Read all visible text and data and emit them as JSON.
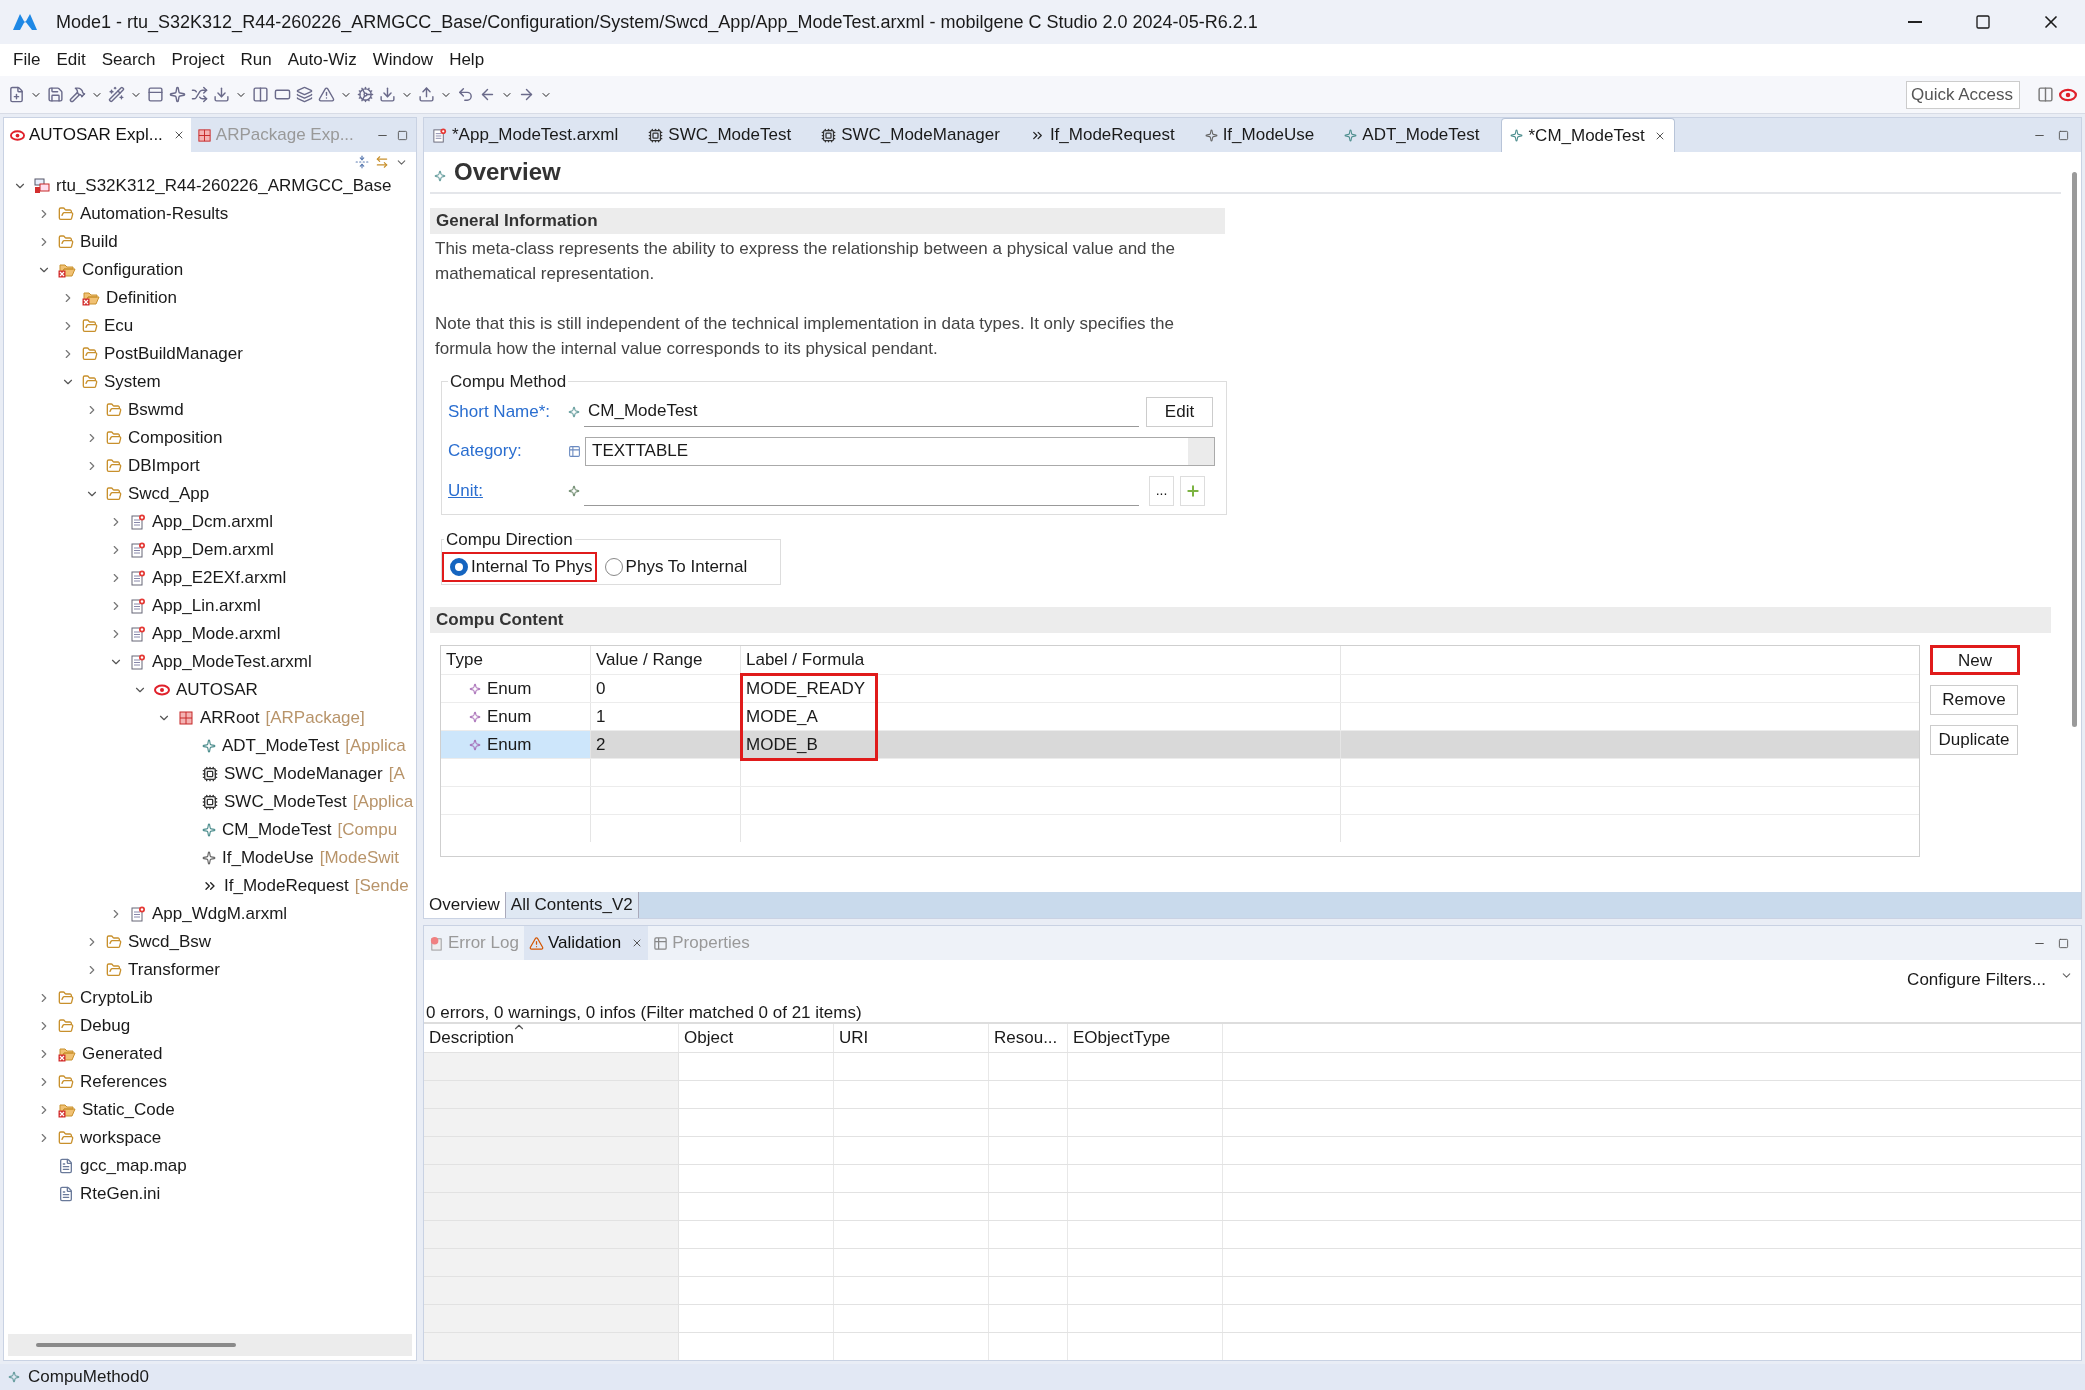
{
  "window": {
    "title": "Mode1 - rtu_S32K312_R44-260226_ARMGCC_Base/Configuration/System/Swcd_App/App_ModeTest.arxml - mobilgene C Studio 2.0 2024-05-R6.2.1"
  },
  "menu": [
    "File",
    "Edit",
    "Search",
    "Project",
    "Run",
    "Auto-Wiz",
    "Window",
    "Help"
  ],
  "quick_access": {
    "placeholder": "Quick Access"
  },
  "left_views": [
    {
      "label": "AUTOSAR Expl...",
      "selected": true,
      "kind": "autosar"
    },
    {
      "label": "ARPackage Exp...",
      "selected": false,
      "kind": "package"
    }
  ],
  "tree": [
    {
      "label": "rtu_S32K312_R44-260226_ARMGCC_Base",
      "kind": "project",
      "expanded": true,
      "children": [
        {
          "label": "Automation-Results",
          "kind": "folder",
          "expanded": false
        },
        {
          "label": "Build",
          "kind": "folder",
          "expanded": false
        },
        {
          "label": "Configuration",
          "kind": "folder-error",
          "expanded": true,
          "children": [
            {
              "label": "Definition",
              "kind": "folder-error",
              "expanded": false
            },
            {
              "label": "Ecu",
              "kind": "folder",
              "expanded": false
            },
            {
              "label": "PostBuildManager",
              "kind": "folder",
              "expanded": false
            },
            {
              "label": "System",
              "kind": "folder",
              "expanded": true,
              "children": [
                {
                  "label": "Bswmd",
                  "kind": "folder",
                  "expanded": false
                },
                {
                  "label": "Composition",
                  "kind": "folder",
                  "expanded": false
                },
                {
                  "label": "DBImport",
                  "kind": "folder",
                  "expanded": false
                },
                {
                  "label": "Swcd_App",
                  "kind": "folder",
                  "expanded": true,
                  "children": [
                    {
                      "label": "App_Dcm.arxml",
                      "kind": "arxml",
                      "expanded": false
                    },
                    {
                      "label": "App_Dem.arxml",
                      "kind": "arxml",
                      "expanded": false
                    },
                    {
                      "label": "App_E2EXf.arxml",
                      "kind": "arxml",
                      "expanded": false
                    },
                    {
                      "label": "App_Lin.arxml",
                      "kind": "arxml",
                      "expanded": false
                    },
                    {
                      "label": "App_Mode.arxml",
                      "kind": "arxml",
                      "expanded": false
                    },
                    {
                      "label": "App_ModeTest.arxml",
                      "kind": "arxml",
                      "expanded": true,
                      "children": [
                        {
                          "label": "AUTOSAR",
                          "kind": "autosar",
                          "expanded": true,
                          "children": [
                            {
                              "label": "ARRoot",
                              "suffix": "[ARPackage]",
                              "kind": "package",
                              "expanded": true,
                              "children": [
                                {
                                  "label": "ADT_ModeTest",
                                  "suffix": "[Applica",
                                  "kind": "element"
                                },
                                {
                                  "label": "SWC_ModeManager",
                                  "suffix": "[A",
                                  "kind": "component"
                                },
                                {
                                  "label": "SWC_ModeTest",
                                  "suffix": "[Applica",
                                  "kind": "component"
                                },
                                {
                                  "label": "CM_ModeTest",
                                  "suffix": "[Compu",
                                  "kind": "element"
                                },
                                {
                                  "label": "If_ModeUse",
                                  "suffix": "[ModeSwit",
                                  "kind": "interface"
                                },
                                {
                                  "label": "If_ModeRequest",
                                  "suffix": "[Sende",
                                  "kind": "sender"
                                }
                              ]
                            }
                          ]
                        }
                      ]
                    },
                    {
                      "label": "App_WdgM.arxml",
                      "kind": "arxml",
                      "expanded": false
                    }
                  ]
                },
                {
                  "label": "Swcd_Bsw",
                  "kind": "folder",
                  "expanded": false
                },
                {
                  "label": "Transformer",
                  "kind": "folder",
                  "expanded": false
                }
              ]
            }
          ]
        },
        {
          "label": "CryptoLib",
          "kind": "folder",
          "expanded": false
        },
        {
          "label": "Debug",
          "kind": "folder",
          "expanded": false
        },
        {
          "label": "Generated",
          "kind": "folder-error",
          "expanded": false
        },
        {
          "label": "References",
          "kind": "folder",
          "expanded": false
        },
        {
          "label": "Static_Code",
          "kind": "folder-error",
          "expanded": false
        },
        {
          "label": "workspace",
          "kind": "folder",
          "expanded": false
        },
        {
          "label": "gcc_map.map",
          "kind": "text-file"
        },
        {
          "label": "RteGen.ini",
          "kind": "text-file"
        }
      ]
    }
  ],
  "editor_tabs": [
    {
      "label": "*App_ModeTest.arxml",
      "kind": "arxml",
      "selected": false
    },
    {
      "label": "SWC_ModeTest",
      "kind": "component",
      "selected": false
    },
    {
      "label": "SWC_ModeManager",
      "kind": "component",
      "selected": false
    },
    {
      "label": "If_ModeRequest",
      "kind": "sender",
      "selected": false
    },
    {
      "label": "If_ModeUse",
      "kind": "interface",
      "selected": false
    },
    {
      "label": "ADT_ModeTest",
      "kind": "element",
      "selected": false
    },
    {
      "label": "*CM_ModeTest",
      "kind": "element",
      "selected": true
    }
  ],
  "overview": {
    "title": "Overview"
  },
  "general_information": {
    "heading": "General Information",
    "paragraphs": [
      "This meta-class represents the ability to express the relationship between a physical value and the mathematical representation.",
      "Note that this is still independent of the technical implementation in data types. It only specifies the formula how the internal value corresponds to its physical pendant."
    ]
  },
  "compu_method": {
    "legend": "Compu Method",
    "fields": [
      {
        "kind": "name",
        "label": "Short Name*:",
        "value": "CM_ModeTest",
        "button": "Edit"
      },
      {
        "kind": "combo",
        "label": "Category:",
        "value": "TEXTTABLE"
      },
      {
        "kind": "reference",
        "label": "Unit:",
        "button": "..."
      }
    ]
  },
  "compu_direction": {
    "legend": "Compu Direction",
    "options": [
      {
        "label": "Internal To Phys",
        "selected": true,
        "highlighted": true
      },
      {
        "label": "Phys To Internal",
        "selected": false,
        "highlighted": false
      }
    ]
  },
  "compu_content": {
    "heading": "Compu Content",
    "columns": [
      "Type",
      "Value / Range",
      "Label / Formula"
    ],
    "label_highlighted": true,
    "rows": [
      {
        "type": "Enum",
        "value": "0",
        "label": "MODE_READY",
        "selected": false
      },
      {
        "type": "Enum",
        "value": "1",
        "label": "MODE_A",
        "selected": false
      },
      {
        "type": "Enum",
        "value": "2",
        "label": "MODE_B",
        "selected": true
      }
    ],
    "buttons": [
      {
        "label": "New",
        "highlighted": true
      },
      {
        "label": "Remove",
        "highlighted": false
      },
      {
        "label": "Duplicate",
        "highlighted": false
      }
    ]
  },
  "editor_pages": [
    {
      "label": "Overview",
      "selected": true
    },
    {
      "label": "All Contents_V2",
      "selected": false
    }
  ],
  "lower_views": [
    {
      "label": "Error Log",
      "kind": "error-log",
      "selected": false
    },
    {
      "label": "Validation",
      "kind": "validation",
      "selected": true
    },
    {
      "label": "Properties",
      "kind": "properties",
      "selected": false
    }
  ],
  "validation": {
    "configure_filters": "Configure Filters...",
    "summary": "0 errors, 0 warnings, 0 infos (Filter matched 0 of 21 items)",
    "columns": [
      "Description",
      "Object",
      "URI",
      "Resou...",
      "EObjectType"
    ]
  },
  "status_bar": {
    "text": "CompuMethod0"
  }
}
